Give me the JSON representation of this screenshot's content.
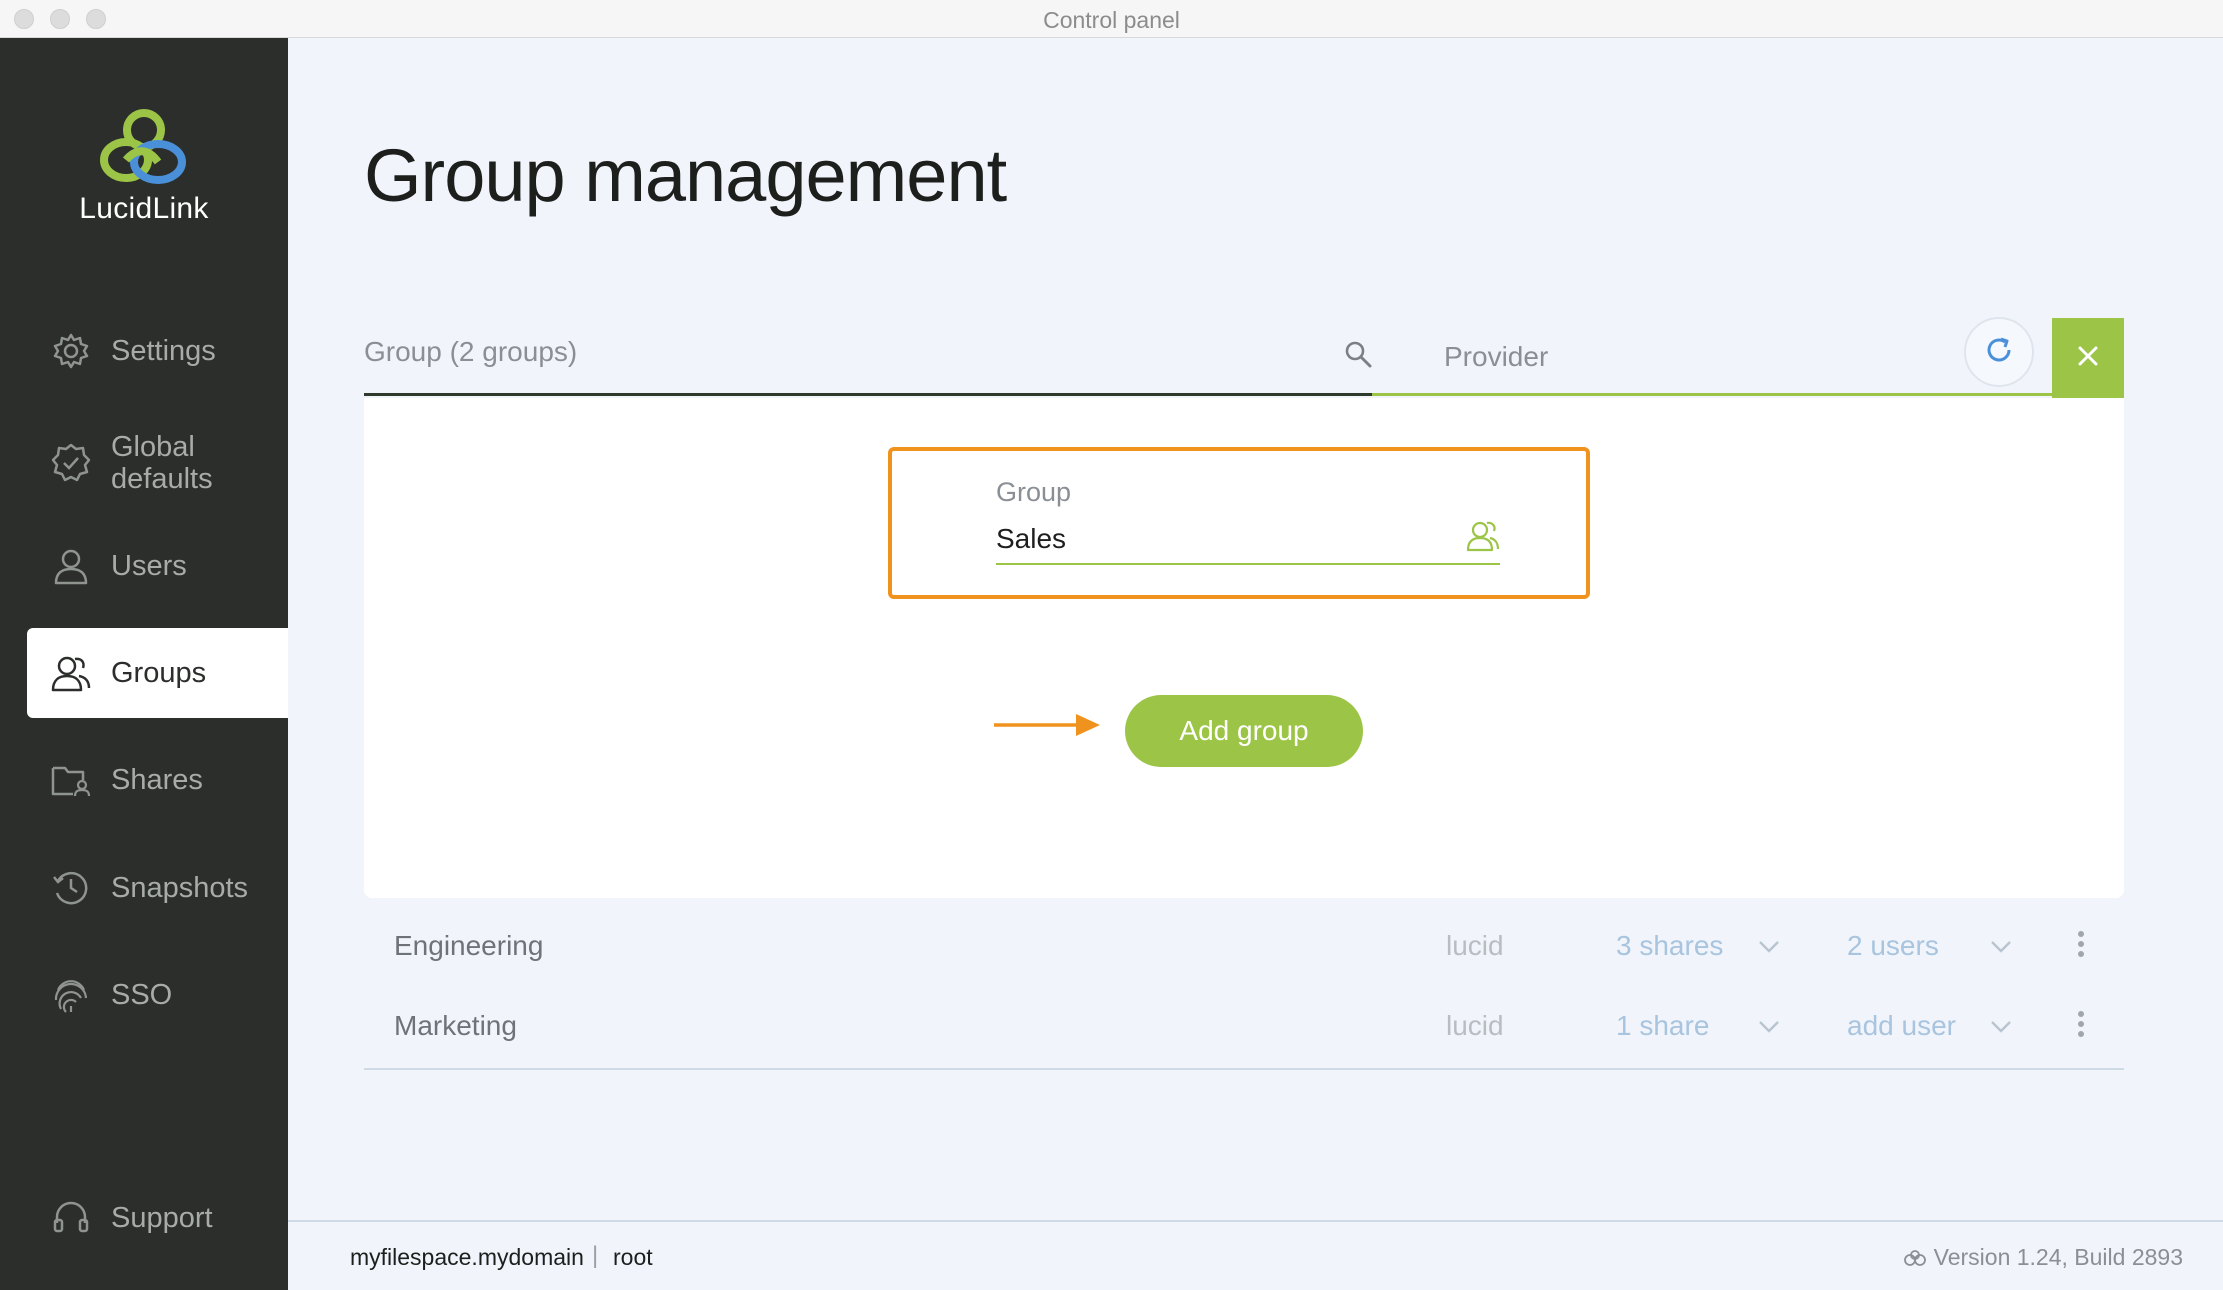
{
  "window": {
    "title": "Control panel"
  },
  "sidebar": {
    "logo_text": "LucidLink",
    "items": [
      {
        "label": "Settings",
        "icon": "gear-icon"
      },
      {
        "label": "Global\ndefaults",
        "icon": "badge-gear-icon"
      },
      {
        "label": "Users",
        "icon": "user-icon"
      },
      {
        "label": "Groups",
        "icon": "group-icon",
        "active": true
      },
      {
        "label": "Shares",
        "icon": "folder-user-icon"
      },
      {
        "label": "Snapshots",
        "icon": "history-icon"
      },
      {
        "label": "SSO",
        "icon": "fingerprint-icon"
      }
    ],
    "support_label": "Support"
  },
  "main": {
    "title": "Group management",
    "group_filter_placeholder": "Group (2 groups)",
    "provider_placeholder": "Provider",
    "new_group": {
      "label": "Group",
      "value": "Sales",
      "add_button": "Add group"
    },
    "groups": [
      {
        "name": "Engineering",
        "provider": "lucid",
        "shares": "3 shares",
        "users": "2 users"
      },
      {
        "name": "Marketing",
        "provider": "lucid",
        "shares": "1 share",
        "users": "add user"
      }
    ]
  },
  "footer": {
    "filespace": "myfilespace.mydomain",
    "separator": "|",
    "user": "root",
    "version": "Version 1.24, Build 2893"
  },
  "colors": {
    "sidebar_bg": "#2b2e2b",
    "accent_green": "#9cc447",
    "highlight_orange": "#f0921e",
    "link_blue": "#a8c4de"
  }
}
